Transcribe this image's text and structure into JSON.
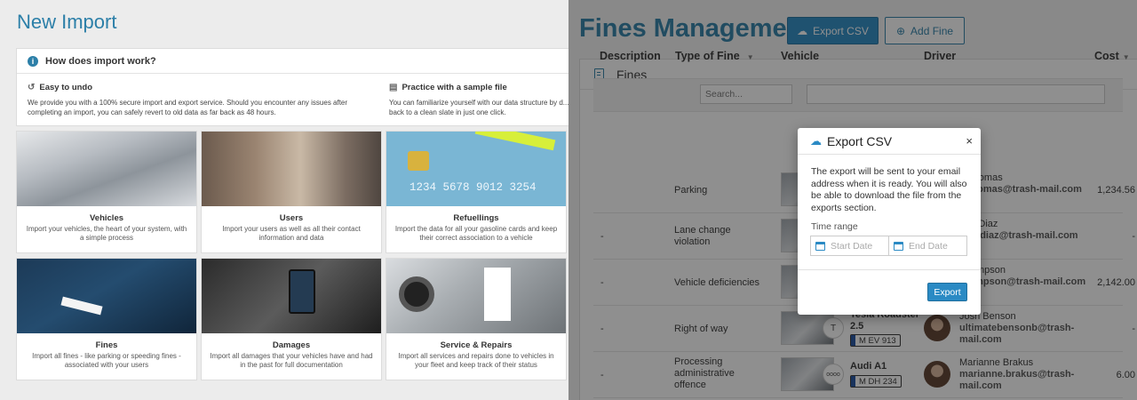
{
  "left": {
    "title": "New Import",
    "how": {
      "heading": "How does import work?",
      "undo_title": "Easy to undo",
      "undo_text": "We provide you with a 100% secure import and export service. Should you encounter any issues after completing an import, you can safely revert to old data as far back as 48 hours.",
      "sample_title": "Practice with a sample file",
      "sample_text": "You can familiarize yourself with our data structure by d... revert back to a clean slate in just one click."
    },
    "cards": [
      {
        "name": "Vehicles",
        "desc": "Import your vehicles, the heart of your system, with a simple process"
      },
      {
        "name": "Users",
        "desc": "Import your users as well as all their contact information and data"
      },
      {
        "name": "Refuellings",
        "desc": "Import the data for all your gasoline cards and keep their correct association to a vehicle",
        "card_number": "1234  5678  9012  3254"
      },
      {
        "name": "Fines",
        "desc": "Import all fines - like parking or speeding fines - associated with your users"
      },
      {
        "name": "Damages",
        "desc": "Import all damages that your vehicles have and had in the past for full documentation"
      },
      {
        "name": "Service & Repairs",
        "desc": "Import all services and repairs done to vehicles in your fleet and keep track of their status"
      }
    ]
  },
  "right": {
    "title": "Fines Management",
    "export_btn": "Export CSV",
    "add_btn": "Add Fine",
    "section": "Fines",
    "columns": {
      "desc": "Description",
      "type": "Type of Fine",
      "vehicle": "Vehicle",
      "driver": "Driver",
      "cost": "Cost"
    },
    "search_placeholder": "Search...",
    "rows": [
      {
        "desc": "",
        "type": "Parking",
        "model": "",
        "plate": "",
        "logo": "",
        "driver": "d Thomas",
        "email": "d.thomas@trash-mail.com",
        "cost": "1,234.56"
      },
      {
        "desc": "-",
        "type": "Lane change violation",
        "model": "",
        "plate": "",
        "logo": "",
        "driver": "ndo Diaz",
        "email": "ndo.diaz@trash-mail.com",
        "cost": "-"
      },
      {
        "desc": "-",
        "type": "Vehicle deficiencies",
        "model": "",
        "plate": "",
        "logo": "",
        "driver": "Thompson",
        "email": "thompson@trash-mail.com",
        "cost": "2,142.00"
      },
      {
        "desc": "-",
        "type": "Right of way",
        "model": "Tesla Roadster 2.5",
        "plate": "M EV 913",
        "logo": "T",
        "driver": "Josh Benson",
        "email": "ultimatebensonb@trash-mail.com",
        "cost": "-"
      },
      {
        "desc": "-",
        "type": "Processing administrative offence",
        "model": "Audi A1",
        "plate": "M DH 234",
        "logo": "oooo",
        "driver": "Marianne Brakus",
        "email": "marianne.brakus@trash-mail.com",
        "cost": "6.00"
      }
    ]
  },
  "modal": {
    "title": "Export CSV",
    "close": "×",
    "message": "The export will be sent to your email address when it is ready. You will also be able to download the file from the exports section.",
    "range_label": "Time range",
    "start_placeholder": "Start Date",
    "end_placeholder": "End Date",
    "export_label": "Export"
  },
  "colors": {
    "accent": "#2c7fa8",
    "button": "#2a8ac4"
  }
}
